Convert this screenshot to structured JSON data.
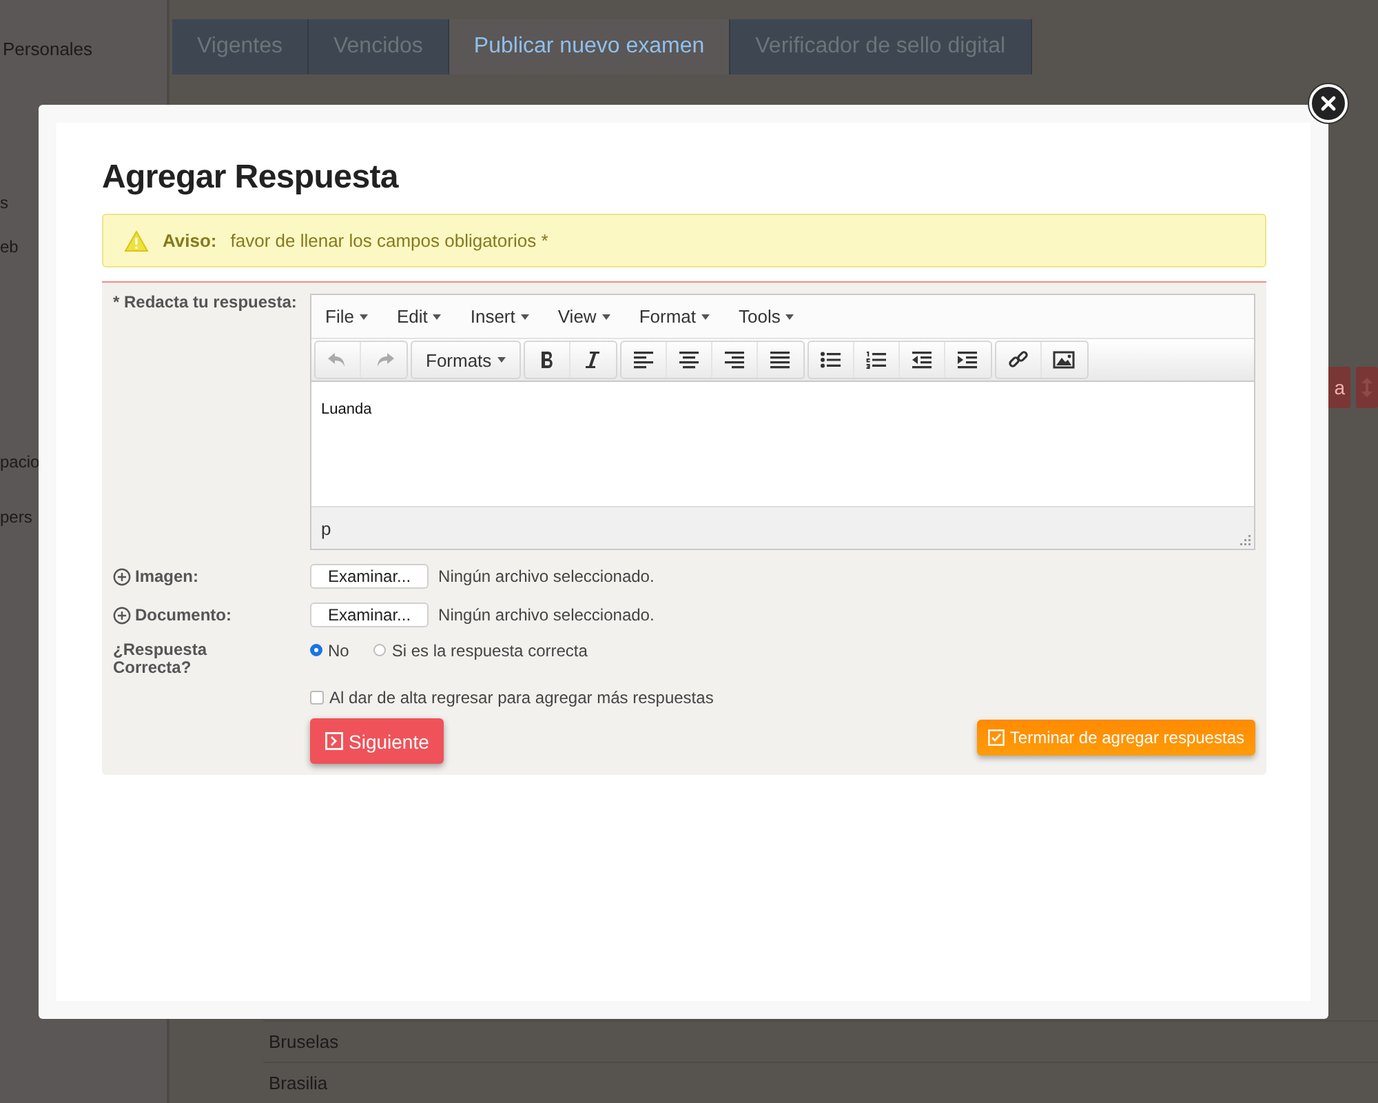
{
  "background": {
    "sidebar_items": [
      "Personales",
      "s",
      "eb",
      "pacio",
      "pers"
    ],
    "tabs": [
      {
        "label": "Vigentes",
        "selected": false
      },
      {
        "label": "Vencidos",
        "selected": false
      },
      {
        "label": "Publicar nuevo examen",
        "selected": true
      },
      {
        "label": "Verificador de sello digital",
        "selected": false
      }
    ],
    "action_button": "a",
    "list_rows": [
      "Bruselas",
      "Brasilia"
    ]
  },
  "modal": {
    "title": "Agregar Respuesta",
    "alert": {
      "label": "Aviso:",
      "message": "favor de llenar los campos obligatorios *"
    },
    "answer_label": "* Redacta tu respuesta:",
    "editor": {
      "menus": [
        "File",
        "Edit",
        "Insert",
        "View",
        "Format",
        "Tools"
      ],
      "toolbar": [
        [
          {
            "kind": "undo",
            "disabled": true
          },
          {
            "kind": "redo",
            "disabled": true
          }
        ],
        [
          {
            "kind": "formats",
            "label": "Formats",
            "disabled": false
          }
        ],
        [
          {
            "kind": "bold",
            "disabled": false
          },
          {
            "kind": "italic",
            "disabled": false
          }
        ],
        [
          {
            "kind": "align-left",
            "disabled": false
          },
          {
            "kind": "align-center",
            "disabled": false
          },
          {
            "kind": "align-right",
            "disabled": false
          },
          {
            "kind": "justify",
            "disabled": false
          }
        ],
        [
          {
            "kind": "bullet-list",
            "disabled": false
          },
          {
            "kind": "numbered-list",
            "disabled": false
          },
          {
            "kind": "outdent",
            "disabled": false
          },
          {
            "kind": "indent",
            "disabled": false
          }
        ],
        [
          {
            "kind": "link",
            "disabled": false
          },
          {
            "kind": "image",
            "disabled": false
          }
        ]
      ],
      "content": "Luanda",
      "path": "p"
    },
    "file_inputs": [
      {
        "label": "Imagen:",
        "button": "Examinar...",
        "status": "Ningún archivo seleccionado."
      },
      {
        "label": "Documento:",
        "button": "Examinar...",
        "status": "Ningún archivo seleccionado."
      }
    ],
    "correct": {
      "label": "¿Respuesta Correcta?",
      "options": [
        {
          "label": "No",
          "selected": true
        },
        {
          "label": "Si es la respuesta correcta",
          "selected": false
        }
      ]
    },
    "return_checkbox": {
      "label": "Al dar de alta regresar para agregar más respuestas",
      "checked": false
    },
    "next_button": "Siguiente",
    "finish_button": "Terminar de agregar respuestas"
  }
}
